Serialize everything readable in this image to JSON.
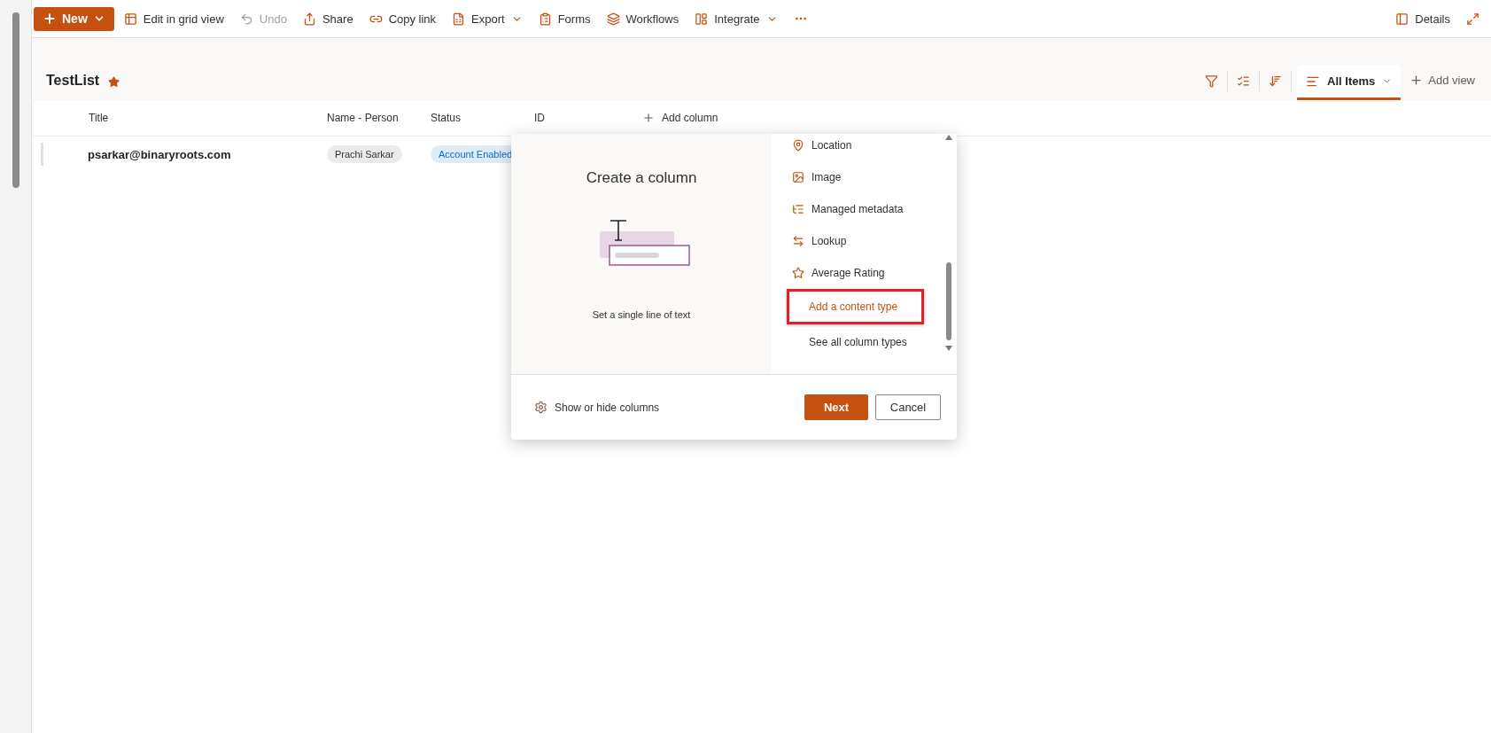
{
  "toolbar": {
    "new_button": "New",
    "items": [
      {
        "label": "Edit in grid view",
        "disabled": false,
        "dropdown": false
      },
      {
        "label": "Undo",
        "disabled": true,
        "dropdown": false
      },
      {
        "label": "Share",
        "disabled": false,
        "dropdown": false
      },
      {
        "label": "Copy link",
        "disabled": false,
        "dropdown": false
      },
      {
        "label": "Export",
        "disabled": false,
        "dropdown": true
      },
      {
        "label": "Forms",
        "disabled": false,
        "dropdown": false
      },
      {
        "label": "Workflows",
        "disabled": false,
        "dropdown": false
      },
      {
        "label": "Integrate",
        "disabled": false,
        "dropdown": true
      }
    ],
    "details": "Details"
  },
  "list": {
    "title": "TestList",
    "favorite": true,
    "views": [
      {
        "label": "All Items",
        "selected": true
      }
    ],
    "add_view": "Add view",
    "columns": [
      "Title",
      "Name - Person",
      "Status",
      "ID"
    ],
    "add_column": "Add column",
    "rows": [
      {
        "title": "psarkar@binaryroots.com",
        "person": "Prachi Sarkar",
        "status": "Account Enabled"
      }
    ]
  },
  "dialog": {
    "title": "Create a column",
    "caption": "Set a single line of text",
    "column_types": [
      {
        "label": "Location",
        "kind": "type",
        "selected": false
      },
      {
        "label": "Image",
        "kind": "type",
        "selected": false
      },
      {
        "label": "Managed metadata",
        "kind": "type",
        "selected": false
      },
      {
        "label": "Lookup",
        "kind": "type",
        "selected": false
      },
      {
        "label": "Average Rating",
        "kind": "type",
        "selected": false
      },
      {
        "label": "Add a content type",
        "kind": "plain",
        "selected": true
      },
      {
        "label": "See all column types",
        "kind": "plain",
        "selected": false
      }
    ],
    "show_hide": "Show or hide columns",
    "buttons": {
      "primary": "Next",
      "secondary": "Cancel"
    }
  }
}
